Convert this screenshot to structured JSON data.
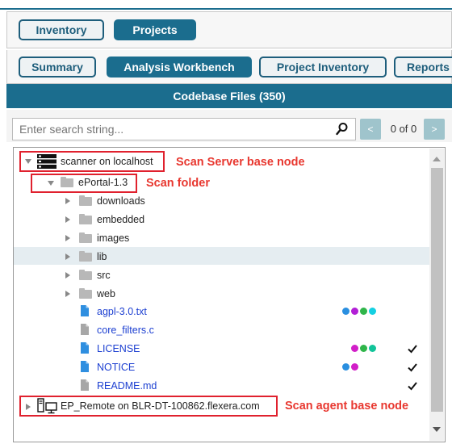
{
  "nav": {
    "inventory_label": "Inventory",
    "projects_label": "Projects"
  },
  "tabs": {
    "summary": "Summary",
    "analysis_workbench": "Analysis Workbench",
    "project_inventory": "Project Inventory",
    "reports": "Reports"
  },
  "panel": {
    "title": "Codebase Files (350)"
  },
  "search": {
    "placeholder": "Enter search string...",
    "count": "0 of 0",
    "prev": "<",
    "next": ">"
  },
  "tree": {
    "scan_server": "scanner on localhost",
    "scan_folder": "ePortal-1.3",
    "folders": [
      "downloads",
      "embedded",
      "images",
      "lib",
      "src",
      "web"
    ],
    "files": [
      "agpl-3.0.txt",
      "core_filters.c",
      "LICENSE",
      "NOTICE",
      "README.md"
    ],
    "scan_agent": "EP_Remote on BLR-DT-100862.flexera.com"
  },
  "annotations": {
    "server": "Scan Server base node",
    "folder": "Scan folder",
    "agent": "Scan agent base node"
  },
  "colors": {
    "accent": "#1b6d8e",
    "annotation": "#e8372f",
    "link": "#1c3fd1",
    "dot_blue": "#2a8fe0",
    "dot_purple": "#b21fd6",
    "dot_green": "#2fb54a",
    "dot_cyan": "#14d0e2",
    "dot_magenta": "#d21fc8",
    "dot_teal": "#12c49a"
  },
  "icons": {
    "server": "server-icon",
    "agent": "agent-computer-icon",
    "search": "magnifier-icon",
    "check": "checkmark-icon"
  }
}
